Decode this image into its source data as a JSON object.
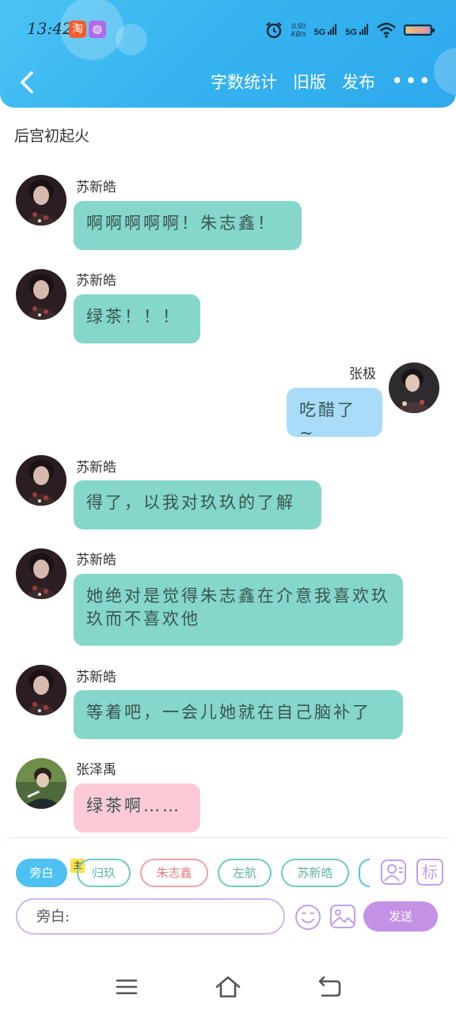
{
  "status_bar": {
    "time": "13:42",
    "app_badges": [
      {
        "icon": "taobao-icon",
        "glyph": "淘",
        "color": "#f25d2c"
      },
      {
        "icon": "app-icon",
        "glyph": "◍",
        "color": "#b06ce8"
      }
    ],
    "net_speed_value": "0.50",
    "net_speed_unit": "KB/s",
    "signal_1": "5G",
    "signal_2": "5G",
    "battery_level": 0.95
  },
  "nav": {
    "word_count_label": "字数统计",
    "old_version_label": "旧版",
    "publish_label": "发布",
    "more_label": "•••"
  },
  "chat": {
    "title": "后宫初起火",
    "messages": [
      {
        "sender": "苏新皓",
        "text": "啊啊啊啊啊！朱志鑫！",
        "side": "left",
        "color": "teal"
      },
      {
        "sender": "苏新皓",
        "text": "绿茶！！！",
        "side": "left",
        "color": "teal"
      },
      {
        "sender": "张极",
        "text": "吃醋了~",
        "side": "right",
        "color": "blue"
      },
      {
        "sender": "苏新皓",
        "text": "得了，以我对玖玖的了解",
        "side": "left",
        "color": "teal"
      },
      {
        "sender": "苏新皓",
        "text": "她绝对是觉得朱志鑫在介意我喜欢玖玖而不喜欢他",
        "side": "left",
        "color": "teal"
      },
      {
        "sender": "苏新皓",
        "text": "等着吧，一会儿她就在自己脑补了",
        "side": "left",
        "color": "teal"
      },
      {
        "sender": "张泽禹",
        "text": "绿茶啊……",
        "side": "left",
        "color": "pink"
      }
    ]
  },
  "input_panel": {
    "roles": [
      {
        "label": "旁白",
        "style": "active"
      },
      {
        "label": "归玖",
        "style": "teal"
      },
      {
        "label": "朱志鑫",
        "style": "red"
      },
      {
        "label": "左航",
        "style": "teal"
      },
      {
        "label": "苏新皓",
        "style": "teal"
      }
    ],
    "main_tag": "主",
    "mark_label": "标",
    "input_placeholder": "旁白:",
    "send_label": "发送"
  },
  "colors": {
    "header": "#35b4ef",
    "teal_bubble": "#85d6cb",
    "blue_bubble": "#a8dcf8",
    "pink_bubble": "#fbcad6",
    "send_button": "#c391e6"
  }
}
